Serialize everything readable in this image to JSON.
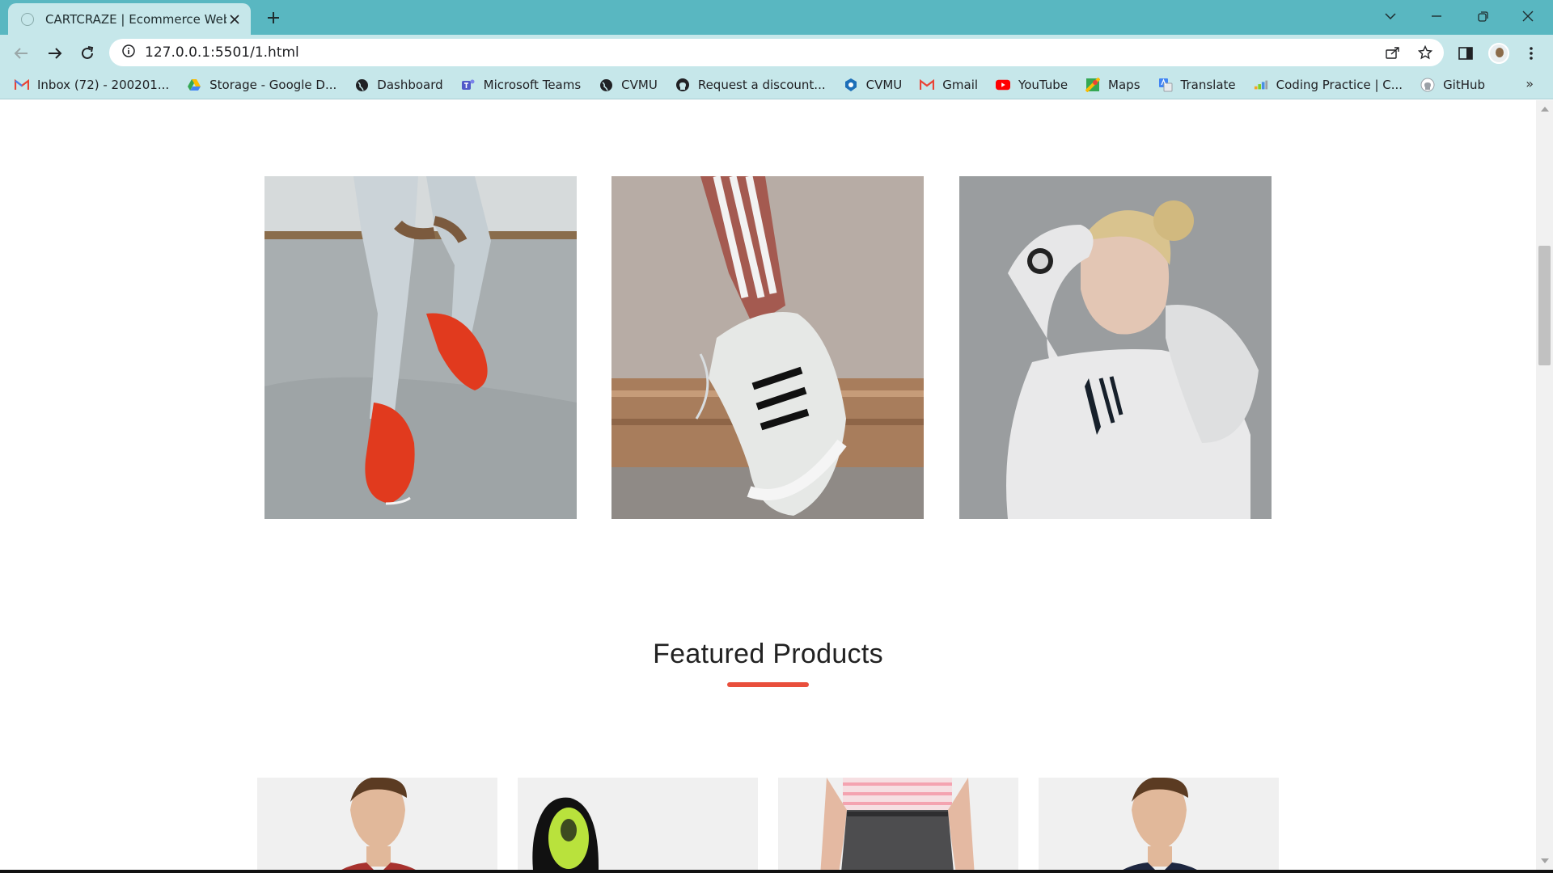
{
  "browser": {
    "tab_title": "CARTCRAZE | Ecommerce Websit",
    "url": "127.0.0.1:5501/1.html",
    "bookmarks": [
      {
        "label": "Inbox (72) - 200201...",
        "icon": "gmail-icon"
      },
      {
        "label": "Storage - Google D...",
        "icon": "google-drive-icon"
      },
      {
        "label": "Dashboard",
        "icon": "globe-icon"
      },
      {
        "label": "Microsoft Teams",
        "icon": "teams-icon"
      },
      {
        "label": "CVMU",
        "icon": "globe-icon"
      },
      {
        "label": "Request a discount...",
        "icon": "github-icon"
      },
      {
        "label": "CVMU",
        "icon": "cvmu-logo-icon"
      },
      {
        "label": "Gmail",
        "icon": "gmail-icon"
      },
      {
        "label": "YouTube",
        "icon": "youtube-icon"
      },
      {
        "label": "Maps",
        "icon": "maps-icon"
      },
      {
        "label": "Translate",
        "icon": "translate-icon"
      },
      {
        "label": "Coding Practice | C...",
        "icon": "coding-icon"
      },
      {
        "label": "GitHub",
        "icon": "github-icon"
      }
    ],
    "colors": {
      "tabbar": "#59b7c1",
      "toolbar": "#c6e7ea"
    }
  },
  "page": {
    "banners": [
      {
        "name": "banner-red-sneakers",
        "alt": "red sneakers"
      },
      {
        "name": "banner-superstar-shoe",
        "alt": "white striped sneaker"
      },
      {
        "name": "banner-hoodie-woman",
        "alt": "woman in white hoodie"
      }
    ],
    "featured": {
      "title": "Featured Products",
      "accent_color": "#e94f3c"
    },
    "products": [
      {
        "name": "product-tshirt-red"
      },
      {
        "name": "product-shoe-black"
      },
      {
        "name": "product-joggers-grey"
      },
      {
        "name": "product-tshirt-navy"
      }
    ]
  }
}
